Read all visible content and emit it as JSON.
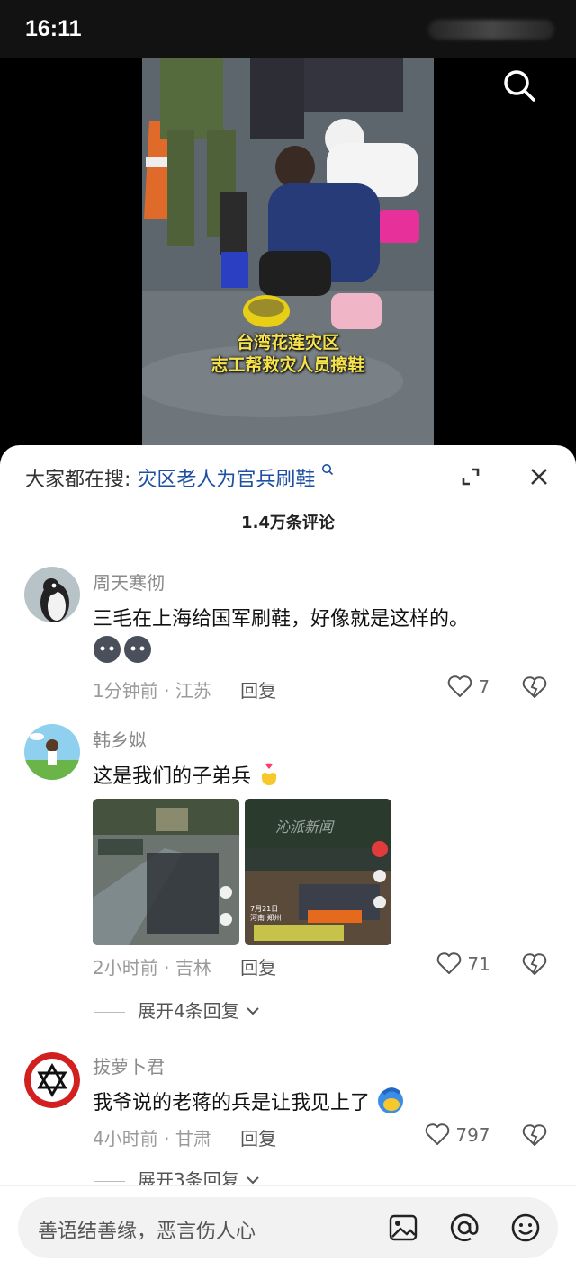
{
  "status": {
    "time": "16:11"
  },
  "video": {
    "caption_line1": "台湾花莲灾区",
    "caption_line2": "志工帮救灾人员擦鞋"
  },
  "hot_search": {
    "prefix": "大家都在搜:",
    "keyword": "灾区老人为官兵刷鞋",
    "suffix_icon": "search-mini-icon"
  },
  "comments_header": {
    "count_label": "1.4万条评论"
  },
  "comments": [
    {
      "author": "周天寒彻",
      "text": "三毛在上海给国军刷鞋，好像就是这样的。",
      "emojis": [
        "blob-face-emoji",
        "blob-face-emoji"
      ],
      "time": "1分钟前",
      "location": "江苏",
      "reply_label": "回复",
      "likes": "7"
    },
    {
      "author": "韩乡姒",
      "text": "这是我们的子弟兵",
      "emoji": "heart-hands-emoji",
      "images": [
        {
          "watermark": ""
        },
        {
          "watermark": "沁派新闻",
          "date_text": "7月21日",
          "place_text": "河南 郑州"
        }
      ],
      "time": "2小时前",
      "location": "吉林",
      "reply_label": "回复",
      "likes": "71",
      "expand_label": "展开4条回复"
    },
    {
      "author": "拔萝卜君",
      "text": "我爷说的老蒋的兵是让我见上了",
      "emoji": "laughing-face-emoji",
      "time": "4小时前",
      "location": "甘肃",
      "reply_label": "回复",
      "likes": "797",
      "expand_label": "展开3条回复"
    }
  ],
  "meta_separator": " · ",
  "input": {
    "placeholder": "善语结善缘，恶言伤人心"
  },
  "colors": {
    "link_blue": "#1d4fa3",
    "sheet_bg": "#ffffff",
    "status_bg": "#121212"
  }
}
